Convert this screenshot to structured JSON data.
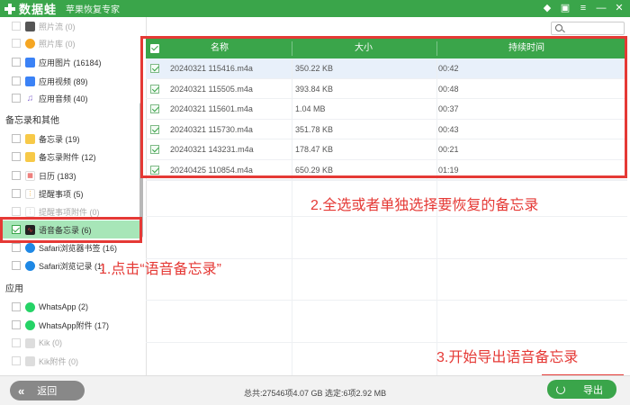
{
  "app": {
    "logo": "数据蛙",
    "subtitle": "苹果恢复专家",
    "window_controls": [
      "diamond-icon",
      "shirt-icon",
      "menu-icon",
      "minimize-icon",
      "close-icon"
    ]
  },
  "sidebar": {
    "top_items": [
      {
        "label": "照片流 (0)",
        "icon": "photo-stream-icon",
        "dim": true
      },
      {
        "label": "照片库 (0)",
        "icon": "photo-library-icon",
        "dim": true
      },
      {
        "label": "应用图片 (16184)",
        "icon": "app-photos-icon",
        "dim": false
      },
      {
        "label": "应用视频 (89)",
        "icon": "app-video-icon",
        "dim": false
      },
      {
        "label": "应用音频 (40)",
        "icon": "app-audio-icon",
        "dim": false
      }
    ],
    "section_notes": "备忘录和其他",
    "notes_items": [
      {
        "label": "备忘录 (19)",
        "icon": "notes-icon",
        "dim": false
      },
      {
        "label": "备忘录附件 (12)",
        "icon": "notes-attachment-icon",
        "dim": false
      },
      {
        "label": "日历 (183)",
        "icon": "calendar-icon",
        "dim": false
      },
      {
        "label": "提醒事项 (5)",
        "icon": "reminders-icon",
        "dim": false
      },
      {
        "label": "提醒事项附件 (0)",
        "icon": "reminders-attachment-icon",
        "dim": true
      },
      {
        "label": "语音备忘录 (6)",
        "icon": "voice-memo-icon",
        "dim": false,
        "selected": true
      },
      {
        "label": "Safari浏览器书签 (16)",
        "icon": "safari-icon",
        "dim": false
      },
      {
        "label": "Safari浏览记录 (1)",
        "icon": "safari-history-icon",
        "dim": false
      }
    ],
    "section_apps": "应用",
    "app_items": [
      {
        "label": "WhatsApp (2)",
        "icon": "whatsapp-icon",
        "dim": false
      },
      {
        "label": "WhatsApp附件 (17)",
        "icon": "whatsapp-attachment-icon",
        "dim": false
      },
      {
        "label": "Kik (0)",
        "icon": "kik-icon",
        "dim": true
      },
      {
        "label": "Kik附件 (0)",
        "icon": "kik-attachment-icon",
        "dim": true
      }
    ]
  },
  "table": {
    "columns": [
      "名称",
      "大小",
      "持续时间"
    ],
    "rows": [
      {
        "name": "20240321 115416.m4a",
        "size": "350.22 KB",
        "duration": "00:42"
      },
      {
        "name": "20240321 115505.m4a",
        "size": "393.84 KB",
        "duration": "00:48"
      },
      {
        "name": "20240321 115601.m4a",
        "size": "1.04 MB",
        "duration": "00:37"
      },
      {
        "name": "20240321 115730.m4a",
        "size": "351.78 KB",
        "duration": "00:43"
      },
      {
        "name": "20240321 143231.m4a",
        "size": "178.47 KB",
        "duration": "00:21"
      },
      {
        "name": "20240425 110854.m4a",
        "size": "650.29 KB",
        "duration": "01:19"
      }
    ]
  },
  "annotations": {
    "step1": "1.点击“语音备忘录”",
    "step2": "2.全选或者单独选择要恢复的备忘录",
    "step3": "3.开始导出语音备忘录"
  },
  "footer": {
    "back_label": "返回",
    "status": "总共:27546项4.07 GB 选定:6项2.92 MB",
    "export_label": "导出"
  },
  "colors": {
    "brand_green": "#3aa54a",
    "annotation_red": "#e53935",
    "selected_bg": "#a7e6b8"
  }
}
